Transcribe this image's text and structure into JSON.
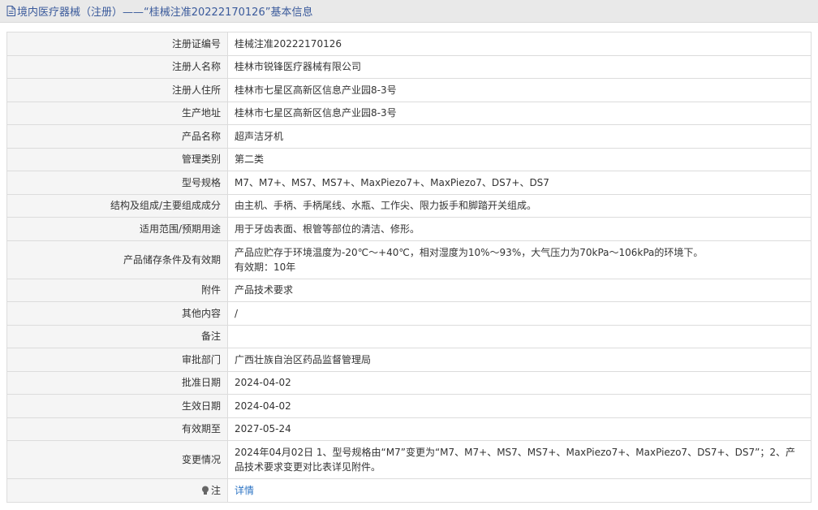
{
  "header": {
    "title": "境内医疗器械（注册）——“桂械注准20222170126”基本信息",
    "icon": "document-icon"
  },
  "rows": [
    {
      "label": "注册证编号",
      "value": "桂械注准20222170126"
    },
    {
      "label": "注册人名称",
      "value": "桂林市锐锋医疗器械有限公司"
    },
    {
      "label": "注册人住所",
      "value": "桂林市七星区高新区信息产业园8-3号"
    },
    {
      "label": "生产地址",
      "value": "桂林市七星区高新区信息产业园8-3号"
    },
    {
      "label": "产品名称",
      "value": "超声洁牙机"
    },
    {
      "label": "管理类别",
      "value": "第二类"
    },
    {
      "label": "型号规格",
      "value": "M7、M7+、MS7、MS7+、MaxPiezo7+、MaxPiezo7、DS7+、DS7"
    },
    {
      "label": "结构及组成/主要组成成分",
      "value": "由主机、手柄、手柄尾线、水瓶、工作尖、限力扳手和脚踏开关组成。"
    },
    {
      "label": "适用范围/预期用途",
      "value": "用于牙齿表面、根管等部位的清洁、修形。"
    },
    {
      "label": "产品储存条件及有效期",
      "value_lines": [
        "产品应贮存于环境温度为-20℃～+40℃，相对湿度为10%～93%，大气压力为70kPa～106kPa的环境下。",
        "有效期：10年"
      ]
    },
    {
      "label": "附件",
      "value": "产品技术要求"
    },
    {
      "label": "其他内容",
      "value": "/"
    },
    {
      "label": "备注",
      "value": ""
    },
    {
      "label": "审批部门",
      "value": "广西壮族自治区药品监督管理局"
    },
    {
      "label": "批准日期",
      "value": "2024-04-02"
    },
    {
      "label": "生效日期",
      "value": "2024-04-02"
    },
    {
      "label": "有效期至",
      "value": "2027-05-24"
    },
    {
      "label": "变更情况",
      "value_lines": [
        "2024年04月02日 1、型号规格由“M7”变更为“M7、M7+、MS7、MS7+、MaxPiezo7+、MaxPiezo7、DS7+、DS7”；2、产",
        "品技术要求变更对比表详见附件。"
      ]
    },
    {
      "label": "注",
      "value": "详情",
      "icon": "lightbulb-icon"
    }
  ],
  "colors": {
    "header_bg": "#e9e9e9",
    "header_text": "#3a5a9b",
    "label_bg": "#f5f5f5",
    "border": "#dcdcdc",
    "link": "#2d74c4"
  }
}
